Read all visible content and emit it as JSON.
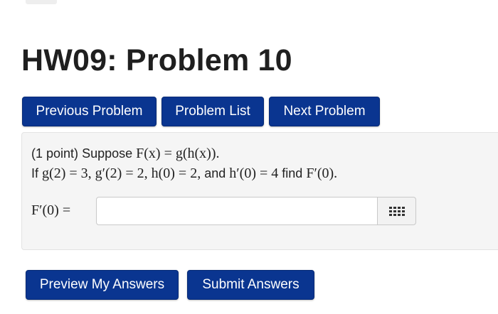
{
  "page": {
    "title": "HW09: Problem 10"
  },
  "nav": {
    "previous_label": "Previous Problem",
    "list_label": "Problem List",
    "next_label": "Next Problem"
  },
  "problem": {
    "points": "(1 point)",
    "line1_text": "Suppose",
    "line1_math": "F(x) = g(h(x)).",
    "line2_if": "If",
    "line2_math_a": "g(2) = 3, g′(2) = 2, h(0) = 2,",
    "line2_and": "and",
    "line2_math_b": "h′(0) = 4",
    "line2_find": "find",
    "line2_math_c": "F′(0)."
  },
  "answer": {
    "label": "F′(0) =",
    "value": "",
    "palette_icon": "grid-icon"
  },
  "actions": {
    "preview_label": "Preview My Answers",
    "submit_label": "Submit Answers"
  },
  "colors": {
    "button_bg": "#0a3590",
    "button_text": "#ffffff",
    "panel_bg": "#f5f5f5"
  }
}
